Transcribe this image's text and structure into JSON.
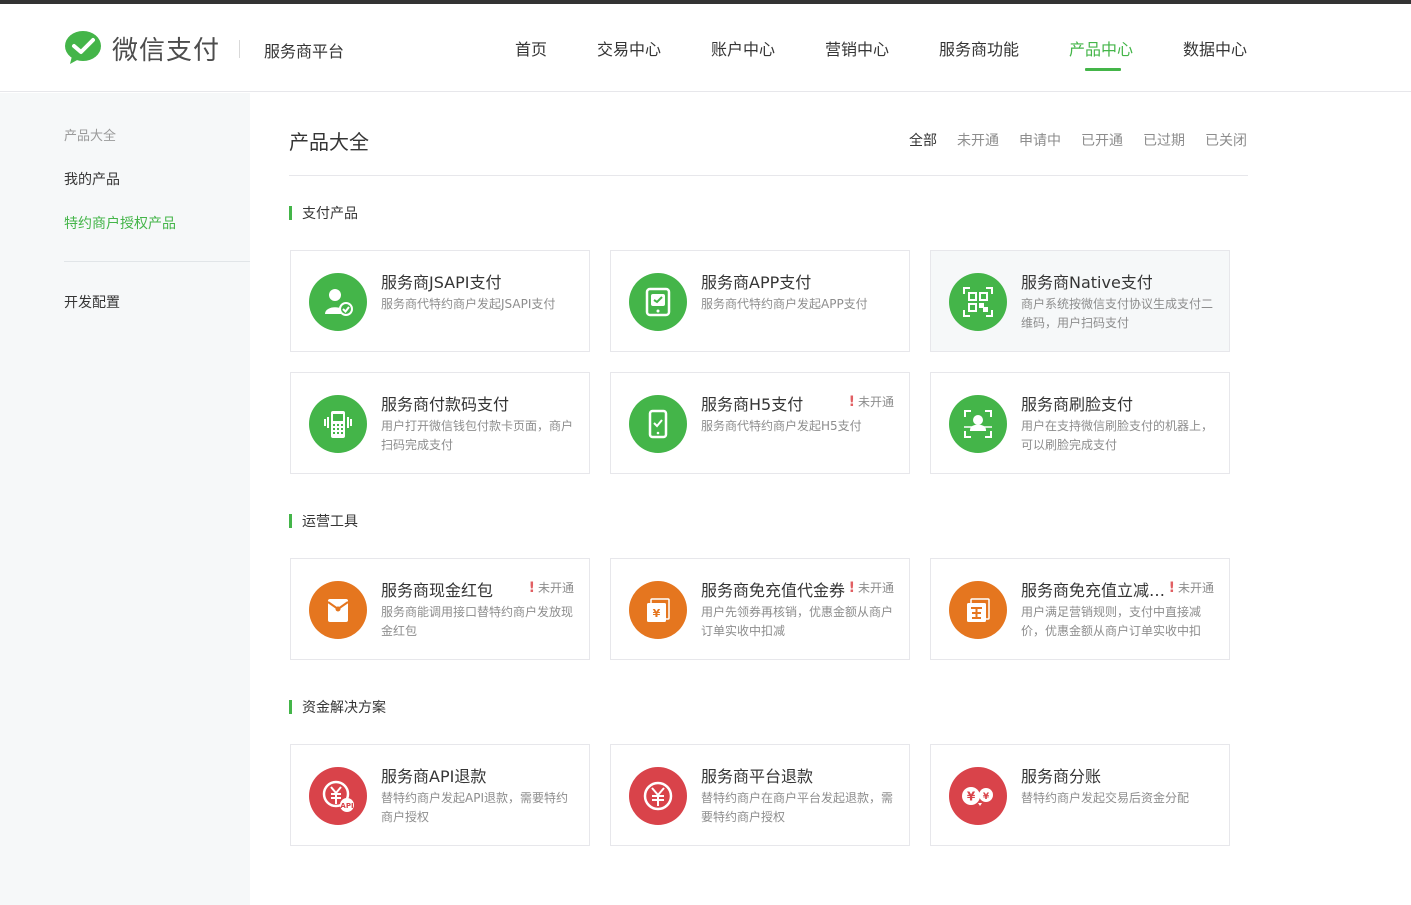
{
  "header": {
    "logo_text": "微信支付",
    "platform": "服务商平台",
    "nav": [
      {
        "label": "首页",
        "active": false
      },
      {
        "label": "交易中心",
        "active": false
      },
      {
        "label": "账户中心",
        "active": false
      },
      {
        "label": "营销中心",
        "active": false
      },
      {
        "label": "服务商功能",
        "active": false
      },
      {
        "label": "产品中心",
        "active": true
      },
      {
        "label": "数据中心",
        "active": false
      }
    ]
  },
  "sidebar": {
    "title": "产品大全",
    "items": [
      {
        "label": "我的产品",
        "active": false
      },
      {
        "label": "特约商户授权产品",
        "active": true
      },
      {
        "label": "开发配置",
        "active": false
      }
    ]
  },
  "main": {
    "title": "产品大全",
    "filters": [
      {
        "label": "全部",
        "active": true
      },
      {
        "label": "未开通",
        "active": false
      },
      {
        "label": "申请中",
        "active": false
      },
      {
        "label": "已开通",
        "active": false
      },
      {
        "label": "已过期",
        "active": false
      },
      {
        "label": "已关闭",
        "active": false
      }
    ],
    "sections": [
      {
        "label": "支付产品",
        "cards": [
          {
            "title": "服务商JSAPI支付",
            "desc": "服务商代特约商户发起JSAPI支付",
            "icon": "user-check-icon",
            "color": "#44b549",
            "badge": ""
          },
          {
            "title": "服务商APP支付",
            "desc": "服务商代特约商户发起APP支付",
            "icon": "tablet-pay-icon",
            "color": "#44b549",
            "badge": ""
          },
          {
            "title": "服务商Native支付",
            "desc": "商户系统按微信支付协议生成支付二维码，用户扫码支付",
            "icon": "qr-code-icon",
            "color": "#44b549",
            "badge": ""
          },
          {
            "title": "服务商付款码支付",
            "desc": "用户打开微信钱包付款卡页面，商户扫码完成支付",
            "icon": "pos-terminal-icon",
            "color": "#44b549",
            "badge": ""
          },
          {
            "title": "服务商H5支付",
            "desc": "服务商代特约商户发起H5支付",
            "icon": "phone-check-icon",
            "color": "#44b549",
            "badge": "未开通"
          },
          {
            "title": "服务商刷脸支付",
            "desc": "用户在支持微信刷脸支付的机器上，可以刷脸完成支付",
            "icon": "face-scan-icon",
            "color": "#44b549",
            "badge": ""
          }
        ]
      },
      {
        "label": "运营工具",
        "cards": [
          {
            "title": "服务商现金红包",
            "desc": "服务商能调用接口替特约商户发放现金红包",
            "icon": "red-packet-icon",
            "color": "#e5761f",
            "badge": "未开通"
          },
          {
            "title": "服务商免充值代金券",
            "desc": "用户先领券再核销，优惠金额从商户订单实收中扣减",
            "icon": "coupon-icon",
            "color": "#e5761f",
            "badge": "未开通"
          },
          {
            "title": "服务商免充值立减与折扣",
            "desc": "用户满足营销规则，支付中直接减价，优惠金额从商户订单实收中扣",
            "icon": "discount-icon",
            "color": "#e5761f",
            "badge": "未开通"
          }
        ]
      },
      {
        "label": "资金解决方案",
        "cards": [
          {
            "title": "服务商API退款",
            "desc": "替特约商户发起API退款，需要特约商户授权",
            "icon": "api-refund-icon",
            "color": "#d9434a",
            "badge": ""
          },
          {
            "title": "服务商平台退款",
            "desc": "替特约商户在商户平台发起退款，需要特约商户授权",
            "icon": "refund-icon",
            "color": "#d9434a",
            "badge": ""
          },
          {
            "title": "服务商分账",
            "desc": "替特约商户发起交易后资金分配",
            "icon": "split-icon",
            "color": "#d9434a",
            "badge": ""
          }
        ]
      }
    ]
  }
}
